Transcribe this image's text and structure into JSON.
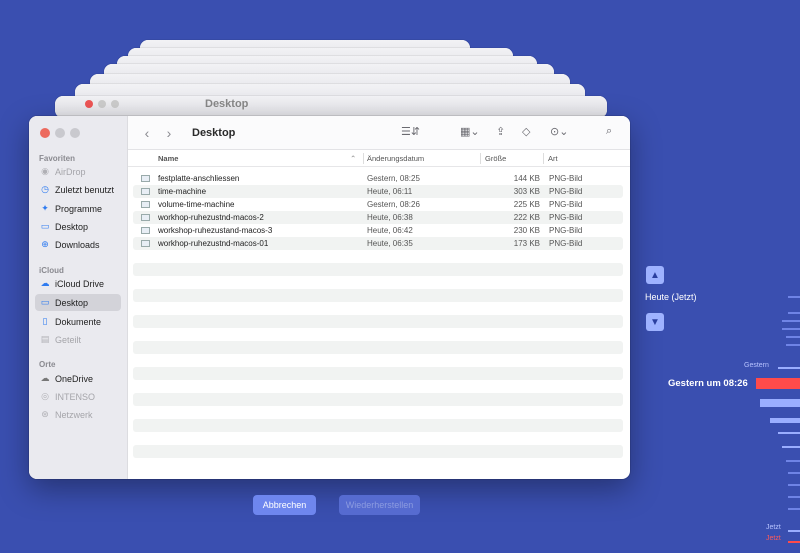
{
  "stack_title": "Desktop",
  "window": {
    "title": "Desktop"
  },
  "sidebar": {
    "sections": [
      {
        "label": "Favoriten"
      },
      {
        "label": "iCloud"
      },
      {
        "label": "Orte"
      }
    ],
    "favorites": [
      {
        "label": "AirDrop",
        "icon": "airdrop-icon",
        "dim": true
      },
      {
        "label": "Zuletzt benutzt",
        "icon": "clock-icon"
      },
      {
        "label": "Programme",
        "icon": "apps-icon"
      },
      {
        "label": "Desktop",
        "icon": "desktop-icon"
      },
      {
        "label": "Downloads",
        "icon": "download-icon"
      }
    ],
    "icloud": [
      {
        "label": "iCloud Drive",
        "icon": "cloud-icon"
      },
      {
        "label": "Desktop",
        "icon": "desktop-icon",
        "selected": true
      },
      {
        "label": "Dokumente",
        "icon": "document-icon"
      },
      {
        "label": "Geteilt",
        "icon": "shared-folder-icon",
        "dim": true
      }
    ],
    "places": [
      {
        "label": "OneDrive",
        "icon": "cloud-icon"
      },
      {
        "label": "INTENSO",
        "icon": "disk-icon",
        "dim": true
      },
      {
        "label": "Netzwerk",
        "icon": "network-icon",
        "dim": true
      }
    ]
  },
  "columns": {
    "name": "Name",
    "date": "Änderungsdatum",
    "size": "Größe",
    "kind": "Art"
  },
  "files": [
    {
      "name": "festplatte-anschliessen",
      "date": "Gestern, 08:25",
      "size": "144 KB",
      "kind": "PNG-Bild"
    },
    {
      "name": "time-machine",
      "date": "Heute, 06:11",
      "size": "303 KB",
      "kind": "PNG-Bild"
    },
    {
      "name": "volume-time-machine",
      "date": "Gestern, 08:26",
      "size": "225 KB",
      "kind": "PNG-Bild"
    },
    {
      "name": "workhop-ruhezustnd-macos-2",
      "date": "Heute, 06:38",
      "size": "222 KB",
      "kind": "PNG-Bild"
    },
    {
      "name": "workshop-ruhezustand-macos-3",
      "date": "Heute, 06:42",
      "size": "230 KB",
      "kind": "PNG-Bild"
    },
    {
      "name": "workhop-ruhezustnd-macos-01",
      "date": "Heute, 06:35",
      "size": "173 KB",
      "kind": "PNG-Bild"
    }
  ],
  "buttons": {
    "cancel": "Abbrechen",
    "restore": "Wiederherstellen"
  },
  "timeline": {
    "now_label": "Heute (Jetzt)",
    "selected_label": "Gestern um 08:26",
    "gestern": "Gestern",
    "jetzt_a": "Jetzt",
    "jetzt_b": "Jetzt"
  },
  "colors": {
    "background": "#3a4fb0",
    "accent": "#6e86ee",
    "timeline_selected": "#ff4b4b"
  }
}
